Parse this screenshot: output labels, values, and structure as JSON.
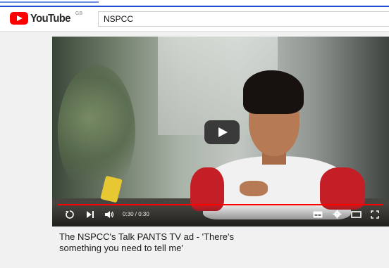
{
  "masthead": {
    "logo_text": "YouTube",
    "region_code": "GB",
    "search_value": "NSPCC"
  },
  "player": {
    "time_display": "0:30 / 0:30",
    "progress": 1.0,
    "progress_color": "#ff0000",
    "icons": [
      "replay-icon",
      "next-icon",
      "volume-icon",
      "subtitles-icon",
      "settings-icon",
      "theater-mode-icon",
      "fullscreen-icon"
    ]
  },
  "video": {
    "title": "The NSPCC's Talk PANTS TV ad - 'There's something you need to tell me'"
  }
}
